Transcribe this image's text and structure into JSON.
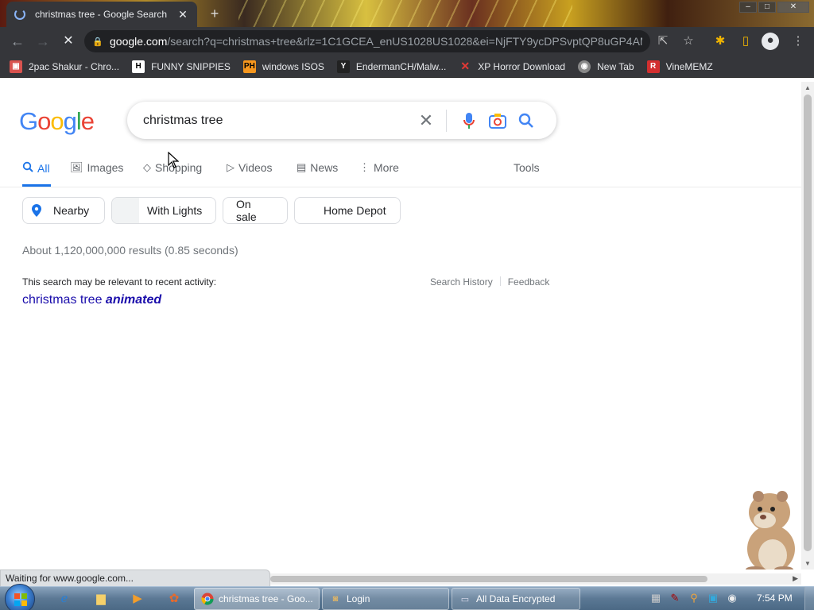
{
  "browser": {
    "tab_title": "christmas tree - Google Search",
    "url_host": "google.com",
    "url_rest": "/search?q=christmas+tree&rlz=1C1GCEA_enUS1028US1028&ei=NjFTY9ycDPSvptQP8uGP4AM...",
    "bookmarks": [
      {
        "label": "2pac Shakur - Chro...",
        "icon": "tupac-favicon"
      },
      {
        "label": "FUNNY SNIPPIES",
        "icon": "h-favicon"
      },
      {
        "label": "windows ISOS",
        "icon": "ph-favicon"
      },
      {
        "label": "EndermanCH/Malw...",
        "icon": "yp-favicon"
      },
      {
        "label": "XP Horror Download",
        "icon": "x-favicon"
      },
      {
        "label": "New Tab",
        "icon": "globe-favicon"
      },
      {
        "label": "VineMEMZ",
        "icon": "r-favicon"
      }
    ],
    "status_text": "Waiting for www.google.com..."
  },
  "google": {
    "logo_text": "Google",
    "query": "christmas tree",
    "tabs": [
      {
        "label": "All",
        "icon": "search-icon"
      },
      {
        "label": "Images",
        "icon": "image-icon"
      },
      {
        "label": "Shopping",
        "icon": "tag-icon"
      },
      {
        "label": "Videos",
        "icon": "play-icon"
      },
      {
        "label": "News",
        "icon": "news-icon"
      },
      {
        "label": "More",
        "icon": "more-icon"
      }
    ],
    "tools_label": "Tools",
    "chips": [
      "Nearby",
      "With Lights",
      "On sale",
      "Home Depot"
    ],
    "result_stats": "About 1,120,000,000 results (0.85 seconds)",
    "relevance_note": "This search may be relevant to recent activity:",
    "search_history": "Search History",
    "feedback": "Feedback",
    "suggestion_plain": "christmas tree",
    "suggestion_bold": "animated"
  },
  "taskbar": {
    "buttons": [
      {
        "label": "christmas tree - Goo...",
        "icon": "chrome-icon"
      },
      {
        "label": "Login",
        "icon": "login-icon"
      },
      {
        "label": "All Data Encrypted",
        "icon": "window-icon"
      }
    ],
    "clock": "7:54 PM"
  },
  "colors": {
    "google_blue": "#4285f4",
    "google_red": "#ea4335",
    "google_yellow": "#fbbc05",
    "google_green": "#34a853",
    "link": "#1a0dab",
    "active_tab": "#1a73e8"
  }
}
